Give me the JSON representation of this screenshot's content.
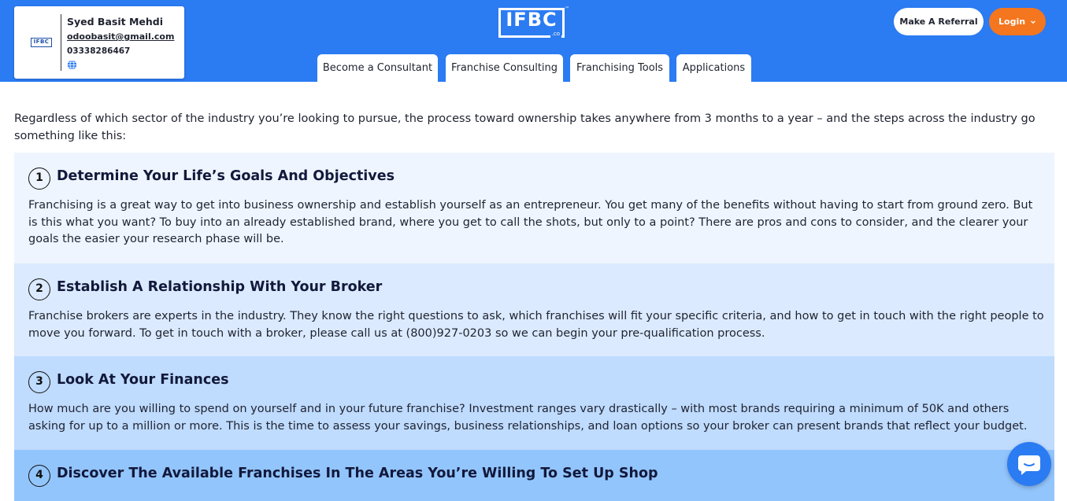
{
  "header": {
    "profile": {
      "logo_text": "IFBC",
      "name": "Syed Basit Mehdi",
      "email": "odoobasit@gmail.com",
      "phone": "03338286467",
      "globe_icon": "globe-icon"
    },
    "brand": {
      "name": "IFBC",
      "suffix": ".co",
      "trademark": "™"
    },
    "tabs": [
      {
        "label": "Become a Consultant"
      },
      {
        "label": "Franchise Consulting"
      },
      {
        "label": "Franchising Tools"
      },
      {
        "label": "Applications"
      }
    ],
    "referral_label": "Make A Referral",
    "login_label": "Login",
    "login_icon": "chevron-down-icon",
    "colors": {
      "header_bg": "#2b7bf2",
      "login_bg": "#f4761f"
    }
  },
  "main": {
    "intro": "Regardless of which sector of the industry you’re looking to pursue, the process toward ownership takes anywhere from 3 months to a year – and the steps across the industry go something like this:",
    "steps": [
      {
        "number": "1",
        "title": "Determine Your Life’s Goals And Objectives",
        "body": "Franchising is a great way to get into business ownership and establish yourself as an entrepreneur. You get many of the benefits without having to start from ground zero. But is this what you want? To buy into an already established brand, where you get to call the shots, but only to a point? There are pros and cons to consider, and the clearer your goals the easier your research phase will be."
      },
      {
        "number": "2",
        "title": "Establish A Relationship With Your Broker",
        "body": "Franchise brokers are experts in the industry. They know the right questions to ask, which franchises will fit your specific criteria, and how to get in touch with the right people to move you forward. To get in touch with a broker, please call us at (800)927-0203 so we can begin your pre-qualification process."
      },
      {
        "number": "3",
        "title": "Look At Your Finances",
        "body": "How much are you willing to spend on yourself and in your future franchise? Investment ranges vary drastically – with most brands requiring a minimum of 50K and others asking for up to a million or more. This is the time to assess your savings, business relationships, and loan options so your broker can present brands that reflect your budget."
      },
      {
        "number": "4",
        "title": "Discover The Available Franchises In The Areas You’re Willing To Set Up Shop",
        "body": ""
      }
    ]
  },
  "chat": {
    "icon": "chat-bubble-icon"
  }
}
